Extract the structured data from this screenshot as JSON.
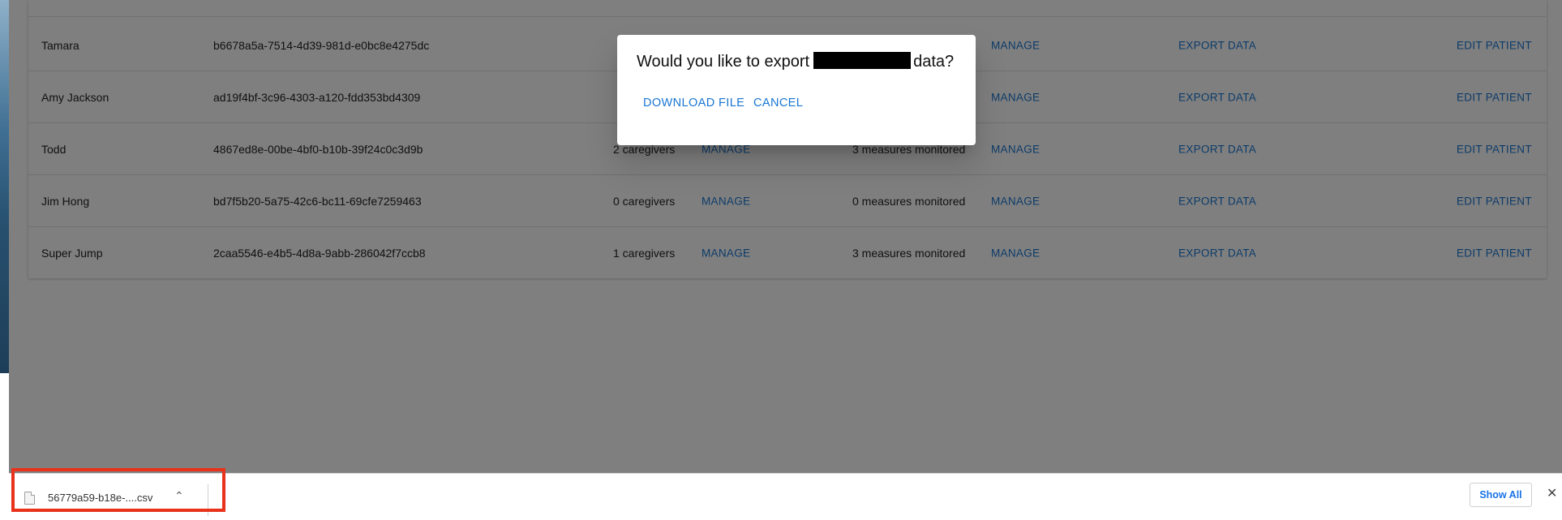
{
  "table": {
    "rows": [
      {
        "name": "Tamara",
        "id": "b6678a5a-7514-4d39-981d-e0bc8e4275dc",
        "caregivers": "",
        "measures": "",
        "manage_cg": "",
        "manage_ms": "MANAGE",
        "export": "EXPORT DATA",
        "edit": "EDIT PATIENT"
      },
      {
        "name": "Amy Jackson",
        "id": "ad19f4bf-3c96-4303-a120-fdd353bd4309",
        "caregivers": "",
        "measures": "",
        "manage_cg": "",
        "manage_ms": "MANAGE",
        "export": "EXPORT DATA",
        "edit": "EDIT PATIENT"
      },
      {
        "name": "Todd",
        "id": "4867ed8e-00be-4bf0-b10b-39f24c0c3d9b",
        "caregivers": "2 caregivers",
        "measures": "3 measures monitored",
        "manage_cg": "MANAGE",
        "manage_ms": "MANAGE",
        "export": "EXPORT DATA",
        "edit": "EDIT PATIENT"
      },
      {
        "name": "Jim Hong",
        "id": "bd7f5b20-5a75-42c6-bc11-69cfe7259463",
        "caregivers": "0 caregivers",
        "measures": "0 measures monitored",
        "manage_cg": "MANAGE",
        "manage_ms": "MANAGE",
        "export": "EXPORT DATA",
        "edit": "EDIT PATIENT"
      },
      {
        "name": "Super Jump",
        "id": "2caa5546-e4b5-4d8a-9abb-286042f7ccb8",
        "caregivers": "1 caregivers",
        "measures": "3 measures monitored",
        "manage_cg": "MANAGE",
        "manage_ms": "MANAGE",
        "export": "EXPORT DATA",
        "edit": "EDIT PATIENT"
      }
    ]
  },
  "dialog": {
    "title_prefix": "Would you like to export",
    "title_suffix": "data?",
    "download_label": "DOWNLOAD FILE",
    "cancel_label": "CANCEL"
  },
  "download_bar": {
    "file_name": "56779a59-b18e-....csv",
    "chevron": "⌃",
    "show_all_label": "Show All",
    "close_glyph": "✕",
    "highlight_color": "#e8321b"
  },
  "colors": {
    "link": "#1976d2",
    "overlay": "rgba(0,0,0,0.5)"
  }
}
